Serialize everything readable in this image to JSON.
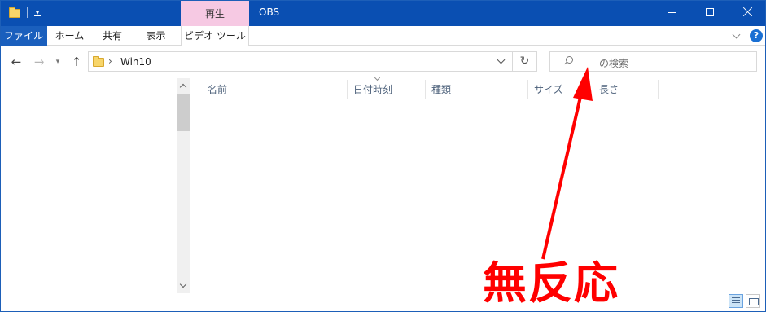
{
  "window": {
    "title": "OBS",
    "context_tab_label": "再生"
  },
  "ribbon": {
    "tabs": [
      {
        "label": "ファイル"
      },
      {
        "label": "ホーム"
      },
      {
        "label": "共有"
      },
      {
        "label": "表示"
      },
      {
        "label": "ビデオ ツール"
      }
    ]
  },
  "address": {
    "path_segment": "Win10"
  },
  "search": {
    "placeholder": "の検索"
  },
  "columns": [
    {
      "label": "名前"
    },
    {
      "label": "日付時刻"
    },
    {
      "label": "種類"
    },
    {
      "label": "サイズ"
    },
    {
      "label": "長さ"
    }
  ],
  "annotation": {
    "text": "無反応",
    "color": "#ff0000"
  },
  "colors": {
    "titlebar": "#0a4fb2",
    "file_tab": "#1a5fbd",
    "context_tab": "#f6c9e3"
  },
  "icons": [
    "folder-icon",
    "dropdown-icon",
    "minimize-icon",
    "maximize-icon",
    "close-icon",
    "chevron-down-icon",
    "help-icon",
    "back-arrow-icon",
    "forward-arrow-icon",
    "up-arrow-icon",
    "refresh-icon",
    "search-icon",
    "details-view-icon",
    "tiles-view-icon"
  ]
}
